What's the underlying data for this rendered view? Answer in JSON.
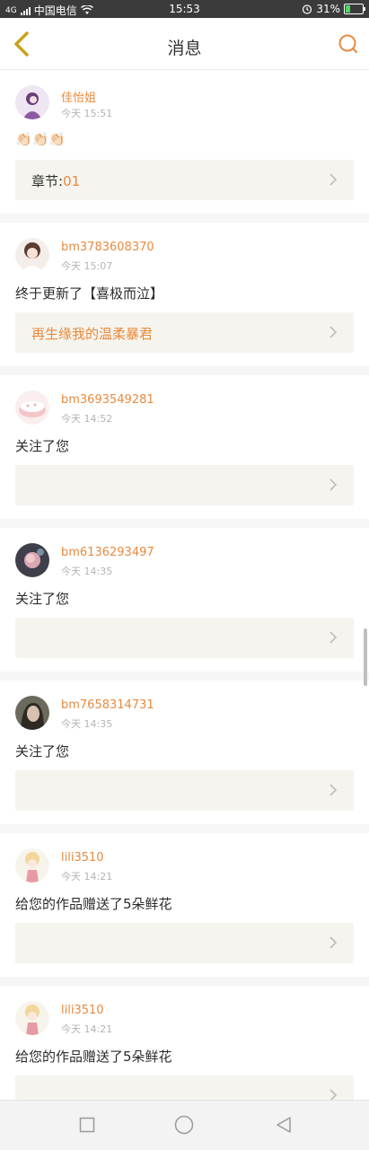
{
  "status_bar": {
    "carrier": "中国电信",
    "time": "15:53",
    "battery": "31%",
    "network_label": "4G",
    "battery_level": 0.31
  },
  "header": {
    "title": "消息",
    "back_icon": "chevron-left-icon",
    "search_icon": "search-icon"
  },
  "colors": {
    "accent": "#e88a3e",
    "back_icon": "#c9a21a",
    "ref_bg": "#f5f4ee"
  },
  "messages": [
    {
      "user": "佳怡姐",
      "time": "今天 15:51",
      "text": "👏🏻👏🏻👏🏻",
      "ref_label": "章节:",
      "ref_value": "01"
    },
    {
      "user": "bm3783608370",
      "time": "今天 15:07",
      "text": "终于更新了【喜极而泣】",
      "ref_label": "",
      "ref_value": "再生缘我的温柔暴君"
    },
    {
      "user": "bm3693549281",
      "time": "今天 14:52",
      "text": "关注了您",
      "ref_label": "",
      "ref_value": ""
    },
    {
      "user": "bm6136293497",
      "time": "今天 14:35",
      "text": "关注了您",
      "ref_label": "",
      "ref_value": ""
    },
    {
      "user": "bm7658314731",
      "time": "今天 14:35",
      "text": "关注了您",
      "ref_label": "",
      "ref_value": ""
    },
    {
      "user": "lili3510",
      "time": "今天 14:21",
      "text": "给您的作品赠送了5朵鲜花",
      "ref_label": "",
      "ref_value": ""
    },
    {
      "user": "lili3510",
      "time": "今天 14:21",
      "text": "给您的作品赠送了5朵鲜花",
      "ref_label": "",
      "ref_value": ""
    }
  ],
  "nav_bar": {
    "recent_icon": "square-icon",
    "home_icon": "circle-icon",
    "back_icon": "triangle-back-icon"
  }
}
